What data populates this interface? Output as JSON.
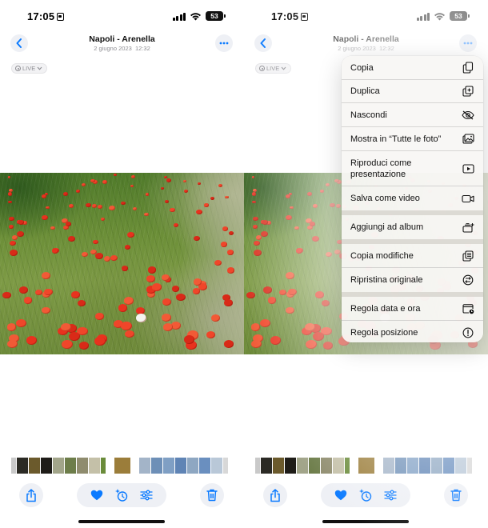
{
  "status_bar": {
    "time": "17:05",
    "battery": "53"
  },
  "photo_header": {
    "title": "Napoli - Arenella",
    "date": "2 giugno 2023",
    "time": "12:32"
  },
  "live_badge": "LIVE",
  "menu": {
    "group1": [
      "Copia",
      "Duplica",
      "Nascondi",
      "Mostra in “Tutte le foto”",
      "Riproduci come presentazione",
      "Salva come video"
    ],
    "group2": [
      "Aggiungi ad album"
    ],
    "group3": [
      "Copia modifiche",
      "Ripristina originale"
    ],
    "group4": [
      "Regola data e ora",
      "Regola posizione"
    ]
  },
  "colors": {
    "accent": "#0a7aff",
    "poppy": "#e8321e",
    "button_bg": "#eef0f5"
  },
  "icons": [
    "chevron-left-icon",
    "ellipsis-icon",
    "share-icon",
    "heart-icon",
    "sparkle-edit-icon",
    "sliders-icon",
    "trash-icon",
    "copy-icon",
    "duplicate-icon",
    "eye-slash-icon",
    "photo-library-icon",
    "play-icon",
    "video-icon",
    "album-add-icon",
    "copy-edits-icon",
    "revert-icon",
    "calendar-clock-icon",
    "info-icon"
  ]
}
